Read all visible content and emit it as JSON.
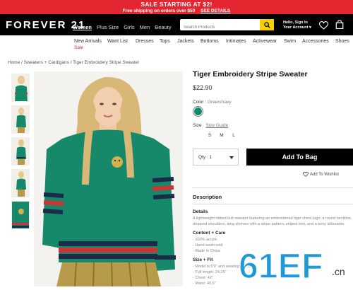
{
  "promo": {
    "headline": "SALE STARTING AT $2!",
    "subline": "Free shipping on orders over $50",
    "details_link": "SEE DETAILS"
  },
  "header": {
    "logo": "FOREVER 21",
    "nav": [
      "Women",
      "Plus Size",
      "Girls",
      "Men",
      "Beauty"
    ],
    "search_placeholder": "Search Products",
    "signin_line1": "Hello, Sign In",
    "signin_line2": "Your Account ▾"
  },
  "subnav": {
    "items": [
      "New Arrivals",
      "Want List",
      "Dresses",
      "Tops",
      "Jackets",
      "Bottoms",
      "Intimates",
      "Activewear",
      "Swim",
      "Accessories",
      "Shoes"
    ],
    "sale": "Sale"
  },
  "breadcrumb": "Home / Sweaters + Cardigans / Tiger Embroidery Stripe Sweater",
  "product": {
    "title": "Tiger Embroidery Stripe Sweater",
    "price": "$22.90",
    "color_label": "Color",
    "color_value": "Green/navy",
    "swatch_color": "#0f8a6a",
    "size_label": "Size",
    "size_guide": "Size Guide",
    "sizes": [
      "S",
      "M",
      "L"
    ],
    "qty": "Qty : 1",
    "add_to_bag": "Add To Bag",
    "wishlist": "Add To Wishlist"
  },
  "description": {
    "heading": "Description",
    "details_h": "Details",
    "details_l1": "A lightweight ribbed knit sweater featuring an embroidered tiger chest logo, a round neckline,",
    "details_l2": "dropped shoulders, long sleeves with a stripe pattern, striped trim, and a boxy silhouette.",
    "content_h": "Content + Care",
    "content_items": [
      "- 100% acrylic",
      "- Hand wash cold",
      "- Made in China"
    ],
    "size_fit_h": "Size + Fit",
    "size_fit_items": [
      "- Model is 5'9\" and wearing a Small",
      "- Full length: 24.25\"",
      "- Chest: 42\"",
      "- Waist: 40.5\""
    ]
  },
  "watermark": {
    "text": "61EF",
    "suffix": ".cn"
  }
}
